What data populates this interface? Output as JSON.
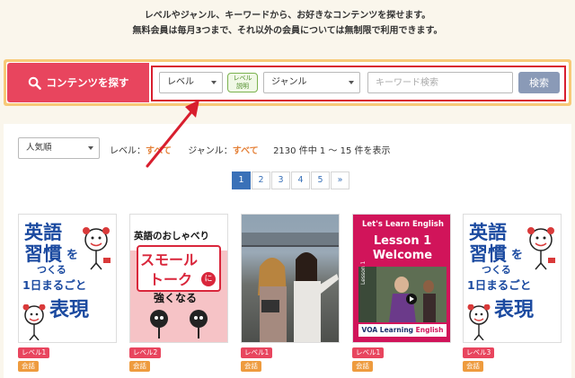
{
  "intro": {
    "line1": "レベルやジャンル、キーワードから、お好きなコンテンツを探せます。",
    "line2": "無料会員は毎月3つまで、それ以外の会員については無制限で利用できます。"
  },
  "search": {
    "heading": "コンテンツを探す",
    "level_select": "レベル",
    "level_help": [
      "レベル",
      "説明"
    ],
    "genre_select": "ジャンル",
    "keyword_placeholder": "キーワード検索",
    "search_button": "検索"
  },
  "results": {
    "sort_select": "人気順",
    "level_label": "レベル：",
    "level_value": "すべて",
    "genre_label": "ジャンル：",
    "genre_value": "すべて",
    "count_text": "2130 件中 1 ～ 15 件を表示"
  },
  "pagination": [
    "1",
    "2",
    "3",
    "4",
    "5",
    "»"
  ],
  "cards": [
    {
      "cover_lines": [
        "英語",
        "習慣",
        "を",
        "つくる",
        "1日まるごと",
        "表現"
      ],
      "level": "レベル1",
      "topic": "会話"
    },
    {
      "cover_lines": [
        "英語のおしゃべり",
        "スモール",
        "トーク",
        "に",
        "強くなる"
      ],
      "level": "レベル2",
      "topic": "会話"
    },
    {
      "cover_lines": [],
      "level": "レベル1",
      "topic": "会話"
    },
    {
      "cover_lines": [
        "Let's Learn English",
        "Lesson 1",
        "Welcome",
        "Lesson 1",
        "VOA Learning",
        "English"
      ],
      "level": "レベル1",
      "topic": "会話"
    },
    {
      "cover_lines": [
        "英語",
        "習慣",
        "を",
        "つくる",
        "1日まるごと",
        "表現"
      ],
      "level": "レベル3",
      "topic": "会話"
    }
  ],
  "colors": {
    "brand_red": "#e8455e",
    "accent_orange": "#e5823a",
    "frame_yellow": "#f7c977",
    "pager_blue": "#3a71b8",
    "highlight_red": "#d81e2e"
  }
}
